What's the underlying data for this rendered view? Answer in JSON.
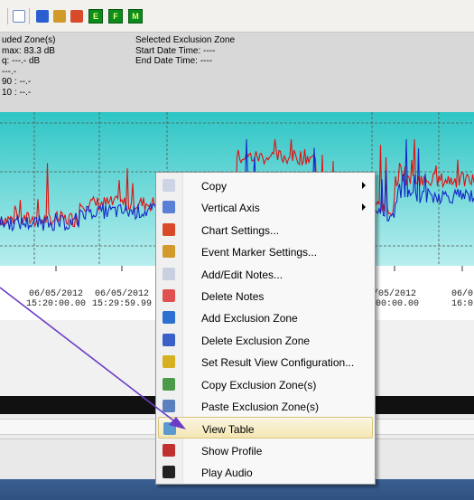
{
  "toolbar": {
    "buttons": [
      {
        "icon": "document-icon",
        "color": "#6a86c9"
      },
      {
        "icon": "transfer-icon",
        "color": "#2b5fd0"
      },
      {
        "icon": "box-icon",
        "color": "#d29a2a"
      },
      {
        "icon": "chart-settings-icon",
        "color": "#d84a2a"
      }
    ],
    "letters": [
      "E",
      "F",
      "M"
    ]
  },
  "info": {
    "left_lines": [
      "uded Zone(s)",
      "max: 83.3 dB",
      "q: ---.- dB",
      "---.-",
      "90 : --.-",
      "10 : --.-"
    ],
    "right_title": "Selected Exclusion Zone",
    "right_start": "Start Date  Time: ----",
    "right_end": "End Date  Time: ----"
  },
  "chart_data": {
    "type": "line",
    "x": [
      "06/05/2012 15:20:00.00",
      "06/05/2012 15:29:59.99",
      "06/05/2012 15:50:00.00",
      "06/05/2012 16:0"
    ],
    "x_tick_labels": [
      {
        "date": "06/05/2012",
        "time": "15:20:00.00"
      },
      {
        "date": "06/05/2012",
        "time": "15:29:59.99"
      },
      {
        "date": "/05/2012",
        "time": ":00:00.00"
      },
      {
        "date": "06/0",
        "time": "16:0"
      }
    ],
    "series": [
      {
        "color": "#1528c8",
        "values": [
          51,
          54,
          50,
          61,
          53,
          58
        ]
      },
      {
        "color": "#e01010",
        "values": [
          52,
          56,
          51,
          68,
          55,
          62
        ]
      }
    ],
    "colors": {
      "band_top": "#2ec5c5",
      "band_bottom": "#b8eeee",
      "grid": "#555555"
    }
  },
  "menu": {
    "items": [
      {
        "label": "Copy",
        "icon": "copy-icon",
        "submenu": true
      },
      {
        "label": "Vertical Axis",
        "icon": "vertical-axis-icon",
        "submenu": true
      },
      {
        "label": "Chart Settings...",
        "icon": "chart-settings-icon",
        "submenu": false
      },
      {
        "label": "Event Marker Settings...",
        "icon": "event-marker-icon",
        "submenu": false
      },
      {
        "label": "Add/Edit Notes...",
        "icon": "notes-icon",
        "submenu": false
      },
      {
        "label": "Delete Notes",
        "icon": "delete-notes-icon",
        "submenu": false
      },
      {
        "label": "Add Exclusion Zone",
        "icon": "add-exclusion-icon",
        "submenu": false
      },
      {
        "label": "Delete Exclusion Zone",
        "icon": "delete-exclusion-icon",
        "submenu": false
      },
      {
        "label": "Set Result View Configuration...",
        "icon": "configuration-icon",
        "submenu": false
      },
      {
        "label": "Copy Exclusion Zone(s)",
        "icon": "copy-exclusion-icon",
        "submenu": false
      },
      {
        "label": "Paste Exclusion Zone(s)",
        "icon": "paste-exclusion-icon",
        "submenu": false
      },
      {
        "label": "View Table",
        "icon": "view-table-icon",
        "submenu": false,
        "highlighted": true
      },
      {
        "label": "Show Profile",
        "icon": "profile-icon",
        "submenu": false
      },
      {
        "label": "Play Audio",
        "icon": "speaker-icon",
        "submenu": false
      }
    ]
  },
  "annotation": {
    "color": "#6a3cc8"
  }
}
